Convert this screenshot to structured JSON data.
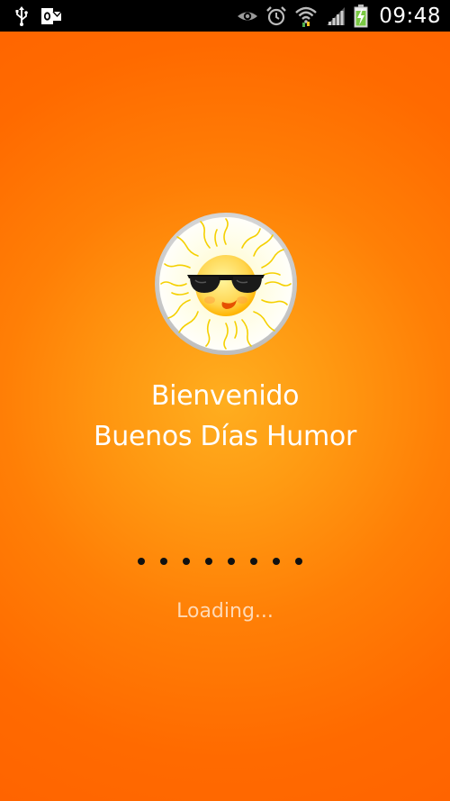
{
  "status_bar": {
    "time": "09:48",
    "left_icons": [
      "usb-icon",
      "outlook-icon"
    ],
    "right_icons": [
      "eye-icon",
      "alarm-icon",
      "wifi-icon",
      "signal-icon",
      "battery-charging-icon"
    ]
  },
  "splash": {
    "title": "Bienvenido",
    "subtitle": "Buenos Días Humor",
    "loading_label": "Loading...",
    "progress_dot_count": 8,
    "logo_icon": "sun-with-sunglasses-icon"
  },
  "colors": {
    "background": "#ff6a00",
    "background_glow": "#ffae1f",
    "text": "#ffffff",
    "loading_text": "#ffd9b5",
    "dots": "#111111",
    "status_bar": "#000000"
  }
}
